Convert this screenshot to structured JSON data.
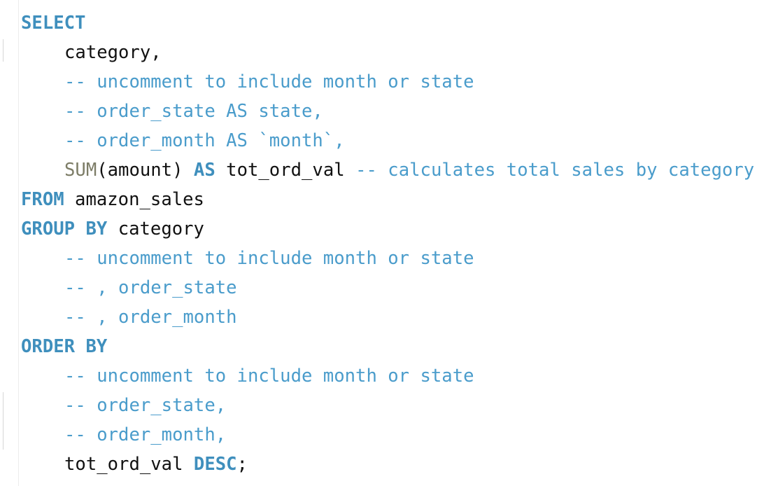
{
  "editor": {
    "lines": [
      {
        "indent": false,
        "tokens": [
          {
            "t": "kw",
            "v": "SELECT"
          }
        ]
      },
      {
        "indent": true,
        "tokens": [
          {
            "t": "tx",
            "v": "category,"
          }
        ]
      },
      {
        "indent": true,
        "tokens": [
          {
            "t": "cm",
            "v": "-- uncomment to include month or state"
          }
        ]
      },
      {
        "indent": true,
        "tokens": [
          {
            "t": "cm",
            "v": "-- order_state AS state,"
          }
        ]
      },
      {
        "indent": true,
        "tokens": [
          {
            "t": "cm",
            "v": "-- order_month AS `month`,"
          }
        ]
      },
      {
        "indent": true,
        "tokens": [
          {
            "t": "fn",
            "v": "SUM"
          },
          {
            "t": "tx",
            "v": "(amount) "
          },
          {
            "t": "kw",
            "v": "AS"
          },
          {
            "t": "tx",
            "v": " tot_ord_val "
          },
          {
            "t": "cm",
            "v": "-- calculates total sales by category"
          }
        ]
      },
      {
        "indent": false,
        "tokens": [
          {
            "t": "kw",
            "v": "FROM"
          },
          {
            "t": "tx",
            "v": " amazon_sales"
          }
        ]
      },
      {
        "indent": false,
        "tokens": [
          {
            "t": "kw",
            "v": "GROUP BY"
          },
          {
            "t": "tx",
            "v": " category"
          }
        ]
      },
      {
        "indent": true,
        "tokens": [
          {
            "t": "cm",
            "v": "-- uncomment to include month or state"
          }
        ]
      },
      {
        "indent": true,
        "tokens": [
          {
            "t": "cm",
            "v": "-- , order_state"
          }
        ]
      },
      {
        "indent": true,
        "tokens": [
          {
            "t": "cm",
            "v": "-- , order_month"
          }
        ]
      },
      {
        "indent": false,
        "tokens": [
          {
            "t": "kw",
            "v": "ORDER BY"
          }
        ]
      },
      {
        "indent": true,
        "tokens": [
          {
            "t": "cm",
            "v": "-- uncomment to include month or state"
          }
        ]
      },
      {
        "indent": true,
        "tokens": [
          {
            "t": "cm",
            "v": "-- order_state,"
          }
        ]
      },
      {
        "indent": true,
        "tokens": [
          {
            "t": "cm",
            "v": "-- order_month,"
          }
        ]
      },
      {
        "indent": true,
        "tokens": [
          {
            "t": "tx",
            "v": "tot_ord_val "
          },
          {
            "t": "kw",
            "v": "DESC"
          },
          {
            "t": "tx",
            "v": ";"
          }
        ]
      }
    ]
  },
  "colors": {
    "keyword": "#3f8fbd",
    "comment": "#4a9ccb",
    "function": "#7d7d67",
    "text": "#111111"
  }
}
